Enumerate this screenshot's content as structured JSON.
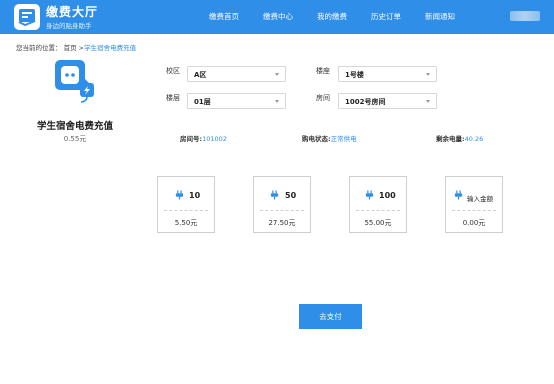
{
  "header": {
    "app_title": "缴费大厅",
    "app_subtitle": "身边的贴身助手",
    "nav": [
      {
        "label": "缴费首页"
      },
      {
        "label": "缴费中心"
      },
      {
        "label": "我的缴费"
      },
      {
        "label": "历史订单"
      },
      {
        "label": "新闻通知"
      }
    ]
  },
  "breadcrumb": {
    "prefix": "您当前的位置：",
    "home": "首页",
    "separator": ">",
    "current": "学生宿舍电费充值"
  },
  "product": {
    "title": "学生宿舍电费充值",
    "price": "0.55元"
  },
  "form": {
    "campus": {
      "label": "校区",
      "value": "A区"
    },
    "building": {
      "label": "楼座",
      "value": "1号楼"
    },
    "floor": {
      "label": "楼层",
      "value": "01层"
    },
    "room": {
      "label": "房间",
      "value": "1002号房间"
    }
  },
  "info": {
    "room_label": "房间号:",
    "room_value": "101002",
    "status_label": "购电状态:",
    "status_value": "正常供电",
    "balance_label": "剩余电量:",
    "balance_value": "40.26"
  },
  "options": [
    {
      "amount": "10",
      "price": "5.50元"
    },
    {
      "amount": "50",
      "price": "27.50元"
    },
    {
      "amount": "100",
      "price": "55.00元"
    },
    {
      "amount": "输入金额",
      "price": "0.00元"
    }
  ],
  "pay_button": "去支付",
  "colors": {
    "accent": "#2f8ee8",
    "header_bg": "#2f8ee8"
  }
}
